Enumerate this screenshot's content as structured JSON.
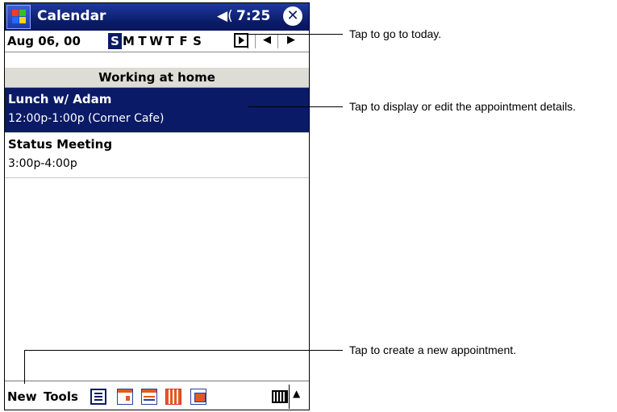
{
  "titlebar": {
    "app_title": "Calendar",
    "speaker_glyph": "◀(",
    "time": "7:25",
    "close_glyph": "✕"
  },
  "nav": {
    "date": "Aug 06, 00",
    "days": [
      "S",
      "M",
      "T",
      "W",
      "T",
      "F",
      "S"
    ],
    "selected_day_index": 0,
    "prev_glyph": "◀",
    "next_glyph": "▶"
  },
  "banner": "Working at home",
  "appointments": [
    {
      "title": "Lunch w/ Adam",
      "subtitle": "12:00p-1:00p (Corner Cafe)",
      "selected": true
    },
    {
      "title": "Status Meeting",
      "subtitle": "3:00p-4:00p",
      "selected": false
    }
  ],
  "toolbar": {
    "new_label": "New",
    "tools_label": "Tools",
    "sip_arrow": "▲",
    "views": [
      "agenda-view",
      "day-view",
      "week-view",
      "month-view",
      "year-view"
    ]
  },
  "callouts": {
    "today": "Tap to go to today.",
    "details": "Tap to display or edit the appointment details.",
    "new": "Tap to create a new appointment."
  },
  "colors": {
    "title_bar": "#0a1a66",
    "selection": "#0a1a66",
    "banner_bg": "#ddddd6"
  }
}
